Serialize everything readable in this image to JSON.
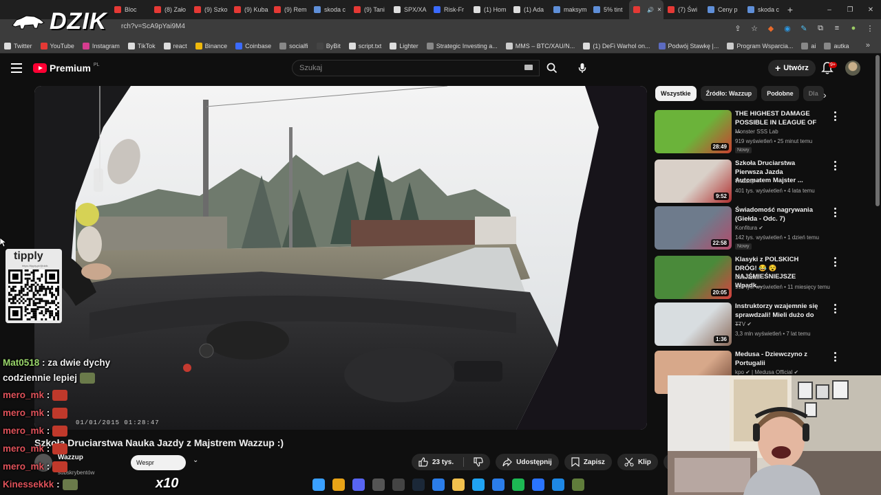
{
  "browser": {
    "tabs": [
      {
        "label": "Bloc",
        "color": "#e53935"
      },
      {
        "label": "(8) Zało",
        "color": "#e53935"
      },
      {
        "label": "(9) Szko",
        "color": "#e53935"
      },
      {
        "label": "(9) Kuba",
        "color": "#e53935"
      },
      {
        "label": "(9) Rem",
        "color": "#e53935"
      },
      {
        "label": "skoda c",
        "color": "#5f8fd8"
      },
      {
        "label": "(9) Tani",
        "color": "#e53935"
      },
      {
        "label": "SPX/XA",
        "color": "#dddddd"
      },
      {
        "label": "Risk-Fr",
        "color": "#3b6bff"
      },
      {
        "label": "(1) Hom",
        "color": "#dddddd"
      },
      {
        "label": "(1) Ada",
        "color": "#dddddd"
      },
      {
        "label": "maksym",
        "color": "#5f8fd8"
      },
      {
        "label": "5% tint",
        "color": "#5f8fd8"
      },
      {
        "label": "",
        "color": "#e53935",
        "active": true
      },
      {
        "label": "(7) Świ",
        "color": "#e53935"
      },
      {
        "label": "Ceny p",
        "color": "#5f8fd8"
      },
      {
        "label": "skoda c",
        "color": "#5f8fd8"
      }
    ],
    "active_tab_close": "×",
    "new_tab": "+",
    "window_controls": [
      "–",
      "❐",
      "✕"
    ],
    "url": "rch?v=ScA9pYai9M4",
    "bookmarks": [
      {
        "label": "Twitter",
        "color": "#dddddd"
      },
      {
        "label": "YouTube",
        "color": "#e53935"
      },
      {
        "label": "Instagram",
        "color": "#d63c8f"
      },
      {
        "label": "TikTok",
        "color": "#dddddd"
      },
      {
        "label": "react",
        "color": "#dddddd"
      },
      {
        "label": "Binance",
        "color": "#f0b90b"
      },
      {
        "label": "Coinbase",
        "color": "#3b6bff"
      },
      {
        "label": "socialfi",
        "color": "#888888"
      },
      {
        "label": "ByBit",
        "color": "#444444"
      },
      {
        "label": "script.txt",
        "color": "#dddddd"
      },
      {
        "label": "Lighter",
        "color": "#dddddd"
      },
      {
        "label": "Strategic Investing a...",
        "color": "#888888"
      },
      {
        "label": "MMS – BTC/XAU/N...",
        "color": "#cccccc"
      },
      {
        "label": "(1) DeFi Warhol on...",
        "color": "#dddddd"
      },
      {
        "label": "Podwój Stawkę |...",
        "color": "#5c6bc0"
      },
      {
        "label": "Program Wsparcia...",
        "color": "#cccccc"
      },
      {
        "label": "ai",
        "color": "#888888"
      },
      {
        "label": "autka",
        "color": "#888888"
      }
    ]
  },
  "overlay": {
    "logo_text": "DZIK",
    "tipply_logo": "tipply",
    "tipply_url": "https://tipply.pl/@dzik",
    "x10": "x10",
    "timestamp": "01/01/2015 01:28:47"
  },
  "youtube": {
    "premium_label": "Premium",
    "region": "PL",
    "search_placeholder": "Szukaj",
    "create_label": "Utwórz",
    "notif_badge": "9+"
  },
  "video": {
    "title": "Szkoła Druciarstwa Nauka Jazdy z Majstrem Wazzup :)",
    "channel": "Wazzup",
    "subs": "tys. subskrybentów",
    "support_label": "Wespr",
    "likes": "23 tys.",
    "share": "Udostępnij",
    "save": "Zapisz",
    "clip": "Klip"
  },
  "sidebar": {
    "chips": [
      "Wszystkie",
      "Źródło: Wazzup",
      "Podobne",
      "Dla"
    ],
    "recs": [
      {
        "title": "THE HIGHEST DAMAGE POSSIBLE IN LEAGUE OF ...",
        "channel": "Monster SSS Lab",
        "meta": "919 wyświetleń • 25 minut temu",
        "badge": "Nowy",
        "duration": "28:49"
      },
      {
        "title": "Szkoła Druciarstwa Pierwsza Jazda Automatem Majster ...",
        "channel": "Wazzup ✔",
        "meta": "401 tys. wyświetleń • 4 lata temu",
        "badge": "",
        "duration": "9:52"
      },
      {
        "title": "Świadomość nagrywania (Giełda - Odc. 7)",
        "channel": "Konfitura ✔",
        "meta": "142 tys. wyświetleń • 1 dzień temu",
        "badge": "Nowy",
        "duration": "22:58"
      },
      {
        "title": "Klasyki z POLSKICH DRÓG! 😂 😵 NAJŚMIEŚNIEJSZE Wpadk...",
        "channel": "EduJazda",
        "meta": "998 tys. wyświetleń • 11 miesięcy temu",
        "badge": "",
        "duration": "20:05"
      },
      {
        "title": "Instruktorzy wzajemnie się sprawdzali! Mieli dużo do ...",
        "channel": "TTV ✔",
        "meta": "3,3 mln wyświetleń • 7 lat temu",
        "badge": "",
        "duration": "1:36"
      },
      {
        "title": "Medusa - Dziewczyno z Portugalii",
        "channel": "kpo ✔ | Medusa Official ✔",
        "meta": "",
        "badge": "",
        "duration": ""
      }
    ]
  },
  "chat": [
    {
      "user": "Mat0518",
      "text": ": za dwie dychy",
      "color": "green"
    },
    {
      "user": "",
      "text": "codziennie lepiej",
      "color": "green"
    },
    {
      "user": "mero_mk",
      "text": ":",
      "color": "red"
    },
    {
      "user": "mero_mk",
      "text": ":",
      "color": "red"
    },
    {
      "user": "mero_mk",
      "text": ":",
      "color": "red"
    },
    {
      "user": "mero_mk",
      "text": ":",
      "color": "red"
    },
    {
      "user": "mero_mk",
      "text": ":",
      "color": "red"
    },
    {
      "user": "Kinessekkk",
      "text": ":",
      "color": "red"
    }
  ],
  "taskbar": [
    {
      "name": "windows-start-icon",
      "color": "#3aa0ff"
    },
    {
      "name": "chrome-icon",
      "color": "#e8a317"
    },
    {
      "name": "discord-icon",
      "color": "#5865f2"
    },
    {
      "name": "app-icon",
      "color": "#555555"
    },
    {
      "name": "obs-icon",
      "color": "#444444"
    },
    {
      "name": "steam-icon",
      "color": "#1b2838"
    },
    {
      "name": "send-icon",
      "color": "#2b7de9"
    },
    {
      "name": "folder-icon",
      "color": "#f2c14e"
    },
    {
      "name": "refresh-icon",
      "color": "#20a4f3"
    },
    {
      "name": "vscode-icon",
      "color": "#2b7de9"
    },
    {
      "name": "spotify-icon",
      "color": "#1db954"
    },
    {
      "name": "app2-icon",
      "color": "#2a74ff"
    },
    {
      "name": "xcode-icon",
      "color": "#1e88e5"
    },
    {
      "name": "game-icon",
      "color": "#607d3b"
    }
  ]
}
